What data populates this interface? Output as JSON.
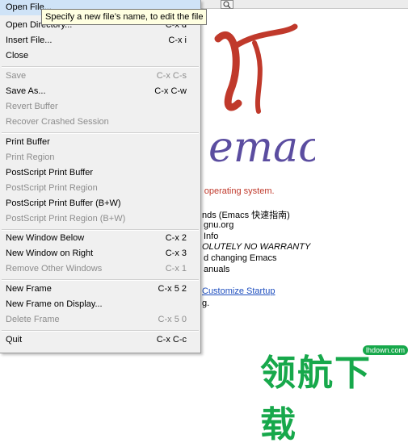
{
  "menu": {
    "items": [
      {
        "label": "Open File...",
        "shortcut": "",
        "disabled": false
      },
      {
        "label": "Open Directory...",
        "shortcut": "C-x d",
        "disabled": false
      },
      {
        "label": "Insert File...",
        "shortcut": "C-x i",
        "disabled": false
      },
      {
        "label": "Close",
        "shortcut": "",
        "disabled": false
      },
      {
        "label": "Save",
        "shortcut": "C-x C-s",
        "disabled": true
      },
      {
        "label": "Save As...",
        "shortcut": "C-x C-w",
        "disabled": false
      },
      {
        "label": "Revert Buffer",
        "shortcut": "",
        "disabled": true
      },
      {
        "label": "Recover Crashed Session",
        "shortcut": "",
        "disabled": true
      },
      {
        "label": "Print Buffer",
        "shortcut": "",
        "disabled": false
      },
      {
        "label": "Print Region",
        "shortcut": "",
        "disabled": true
      },
      {
        "label": "PostScript Print Buffer",
        "shortcut": "",
        "disabled": false
      },
      {
        "label": "PostScript Print Region",
        "shortcut": "",
        "disabled": true
      },
      {
        "label": "PostScript Print Buffer (B+W)",
        "shortcut": "",
        "disabled": false
      },
      {
        "label": "PostScript Print Region (B+W)",
        "shortcut": "",
        "disabled": true
      },
      {
        "label": "New Window Below",
        "shortcut": "C-x 2",
        "disabled": false
      },
      {
        "label": "New Window on Right",
        "shortcut": "C-x 3",
        "disabled": false
      },
      {
        "label": "Remove Other Windows",
        "shortcut": "C-x 1",
        "disabled": true
      },
      {
        "label": "New Frame",
        "shortcut": "C-x 5 2",
        "disabled": false
      },
      {
        "label": "New Frame on Display...",
        "shortcut": "",
        "disabled": false
      },
      {
        "label": "Delete Frame",
        "shortcut": "C-x 5 0",
        "disabled": true
      },
      {
        "label": "Quit",
        "shortcut": "C-x C-c",
        "disabled": false
      }
    ]
  },
  "tooltip": {
    "text": "Specify a new file’s name, to edit the file"
  },
  "splash": {
    "logo_text": "emacs",
    "os_text": "operating system.",
    "line_tutorial": "nds (Emacs 快速指南)",
    "line_gnu": "gnu.org",
    "line_info": "Info",
    "line_warranty": "OLUTELY NO WARRANTY",
    "line_changing": "d changing Emacs",
    "line_manuals": "anuals",
    "customize_link": "Customize Startup",
    "line_g": "g."
  },
  "watermark": {
    "text": "领航下载",
    "badge": "lhdown.com"
  },
  "colors": {
    "logo_red": "#c0392b",
    "logo_purple": "#5b4da0",
    "watermark_green": "#17a84b",
    "link_blue": "#1f4fbf"
  }
}
